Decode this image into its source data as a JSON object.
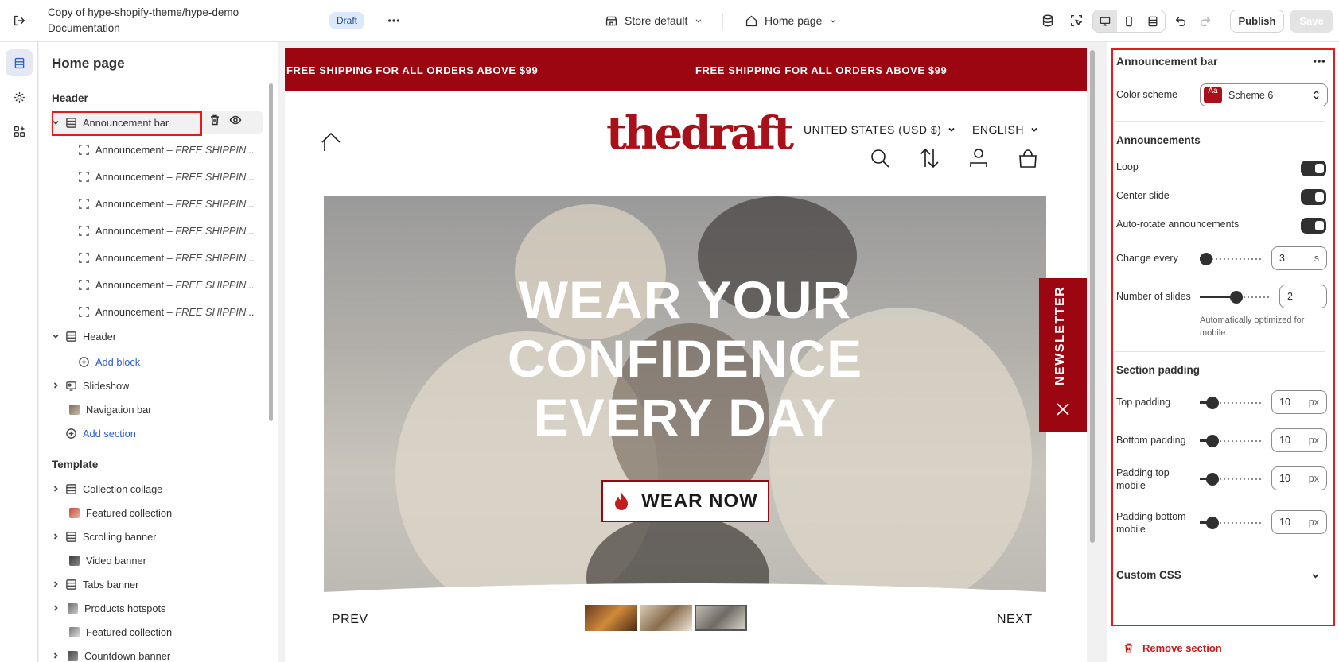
{
  "topbar": {
    "title_line1": "Copy of hype-shopify-theme/hype-demo",
    "title_line2": "Documentation",
    "badge": "Draft",
    "store": "Store default",
    "page": "Home page",
    "publish": "Publish",
    "save": "Save"
  },
  "left": {
    "title": "Home page",
    "header_group": "Header",
    "selected": "Announcement bar",
    "announcement_label": "Announcement",
    "announcement_text": " – FREE SHIPPIN...",
    "header_item": "Header",
    "add_block": "Add block",
    "slideshow": "Slideshow",
    "navigation_bar": "Navigation bar",
    "add_section": "Add section",
    "template_group": "Template",
    "template_items": [
      "Collection collage",
      "Featured collection",
      "Scrolling banner",
      "Video banner",
      "Tabs banner",
      "Products hotspots",
      "Featured collection",
      "Countdown banner"
    ]
  },
  "preview": {
    "announcement_1": "FREE SHIPPING FOR ALL ORDERS ABOVE $99",
    "announcement_2": "FREE SHIPPING FOR ALL ORDERS ABOVE $99",
    "logo": "thedraft",
    "currency": "UNITED STATES (USD $)",
    "language": "ENGLISH",
    "headline_1": "WEAR YOUR",
    "headline_2": "CONFIDENCE",
    "headline_3": "EVERY DAY",
    "cta": "WEAR NOW",
    "newsletter": "NEWSLETTER",
    "prev": "PREV",
    "next": "NEXT"
  },
  "settings": {
    "section_title": "Announcement bar",
    "color_scheme_label": "Color scheme",
    "color_scheme_value": "Scheme 6",
    "swatch_text": "Aa",
    "announcements_heading": "Announcements",
    "loop": "Loop",
    "center_slide": "Center slide",
    "auto_rotate": "Auto-rotate announcements",
    "change_every": "Change every",
    "change_every_value": "3",
    "change_every_unit": "s",
    "number_of_slides": "Number of slides",
    "number_of_slides_value": "2",
    "help_line1": "Automatically optimized for",
    "help_line2": "mobile.",
    "padding_heading": "Section padding",
    "top_padding": "Top padding",
    "bottom_padding": "Bottom padding",
    "padding_top_mobile_1": "Padding top",
    "padding_top_mobile_2": "mobile",
    "padding_bottom_mobile_1": "Padding bottom",
    "padding_bottom_mobile_2": "mobile",
    "pad_value": "10",
    "pad_unit": "px",
    "custom_css": "Custom CSS",
    "remove_section": "Remove section"
  },
  "colors": {
    "brand_red": "#9b0610",
    "highlight": "#e21b1b",
    "accent_blue": "#2c5ecf"
  }
}
